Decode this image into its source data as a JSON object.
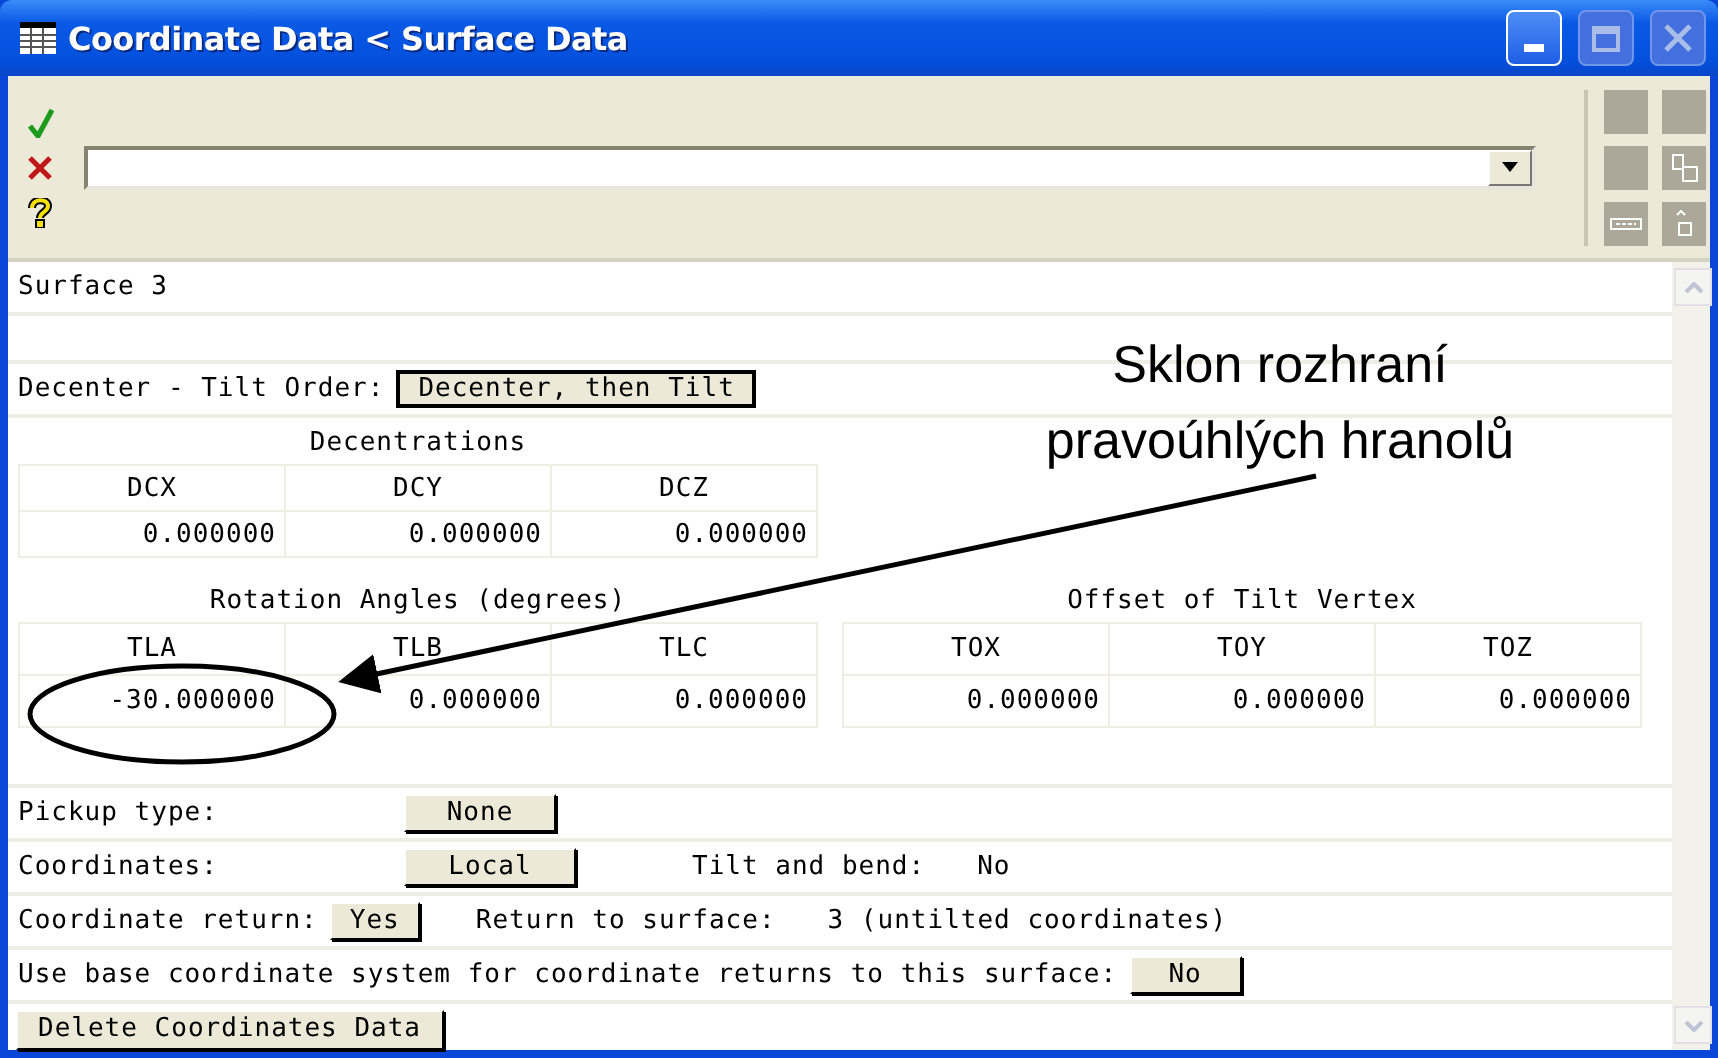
{
  "window": {
    "title": "Coordinate Data < Surface Data"
  },
  "surface_label": "Surface 3",
  "tilt_order": {
    "label": "Decenter - Tilt Order:",
    "value": "Decenter, then Tilt"
  },
  "decentrations": {
    "title": "Decentrations",
    "columns": [
      "DCX",
      "DCY",
      "DCZ"
    ],
    "values": [
      "0.000000",
      "0.000000",
      "0.000000"
    ]
  },
  "rotation_angles": {
    "title": "Rotation Angles (degrees)",
    "columns": [
      "TLA",
      "TLB",
      "TLC"
    ],
    "values": [
      "-30.000000",
      "0.000000",
      "0.000000"
    ]
  },
  "tilt_vertex_offset": {
    "title": "Offset of Tilt Vertex",
    "columns": [
      "TOX",
      "TOY",
      "TOZ"
    ],
    "values": [
      "0.000000",
      "0.000000",
      "0.000000"
    ]
  },
  "pickup": {
    "label": "Pickup type:",
    "value": "None"
  },
  "coordinates": {
    "label": "Coordinates:",
    "value": "Local",
    "tilt_label": "Tilt and bend:",
    "tilt_value": "No"
  },
  "coordinate_return": {
    "label": "Coordinate return:",
    "value": "Yes",
    "return_label": "Return to surface:",
    "return_value": "3 (untilted coordinates)"
  },
  "base_system": {
    "label": "Use base coordinate system for coordinate returns to this surface:",
    "value": "No"
  },
  "delete_button": "Delete Coordinates Data",
  "annotation": {
    "lines": [
      "Sklon rozhraní",
      "pravoúhlých hranolů"
    ]
  }
}
